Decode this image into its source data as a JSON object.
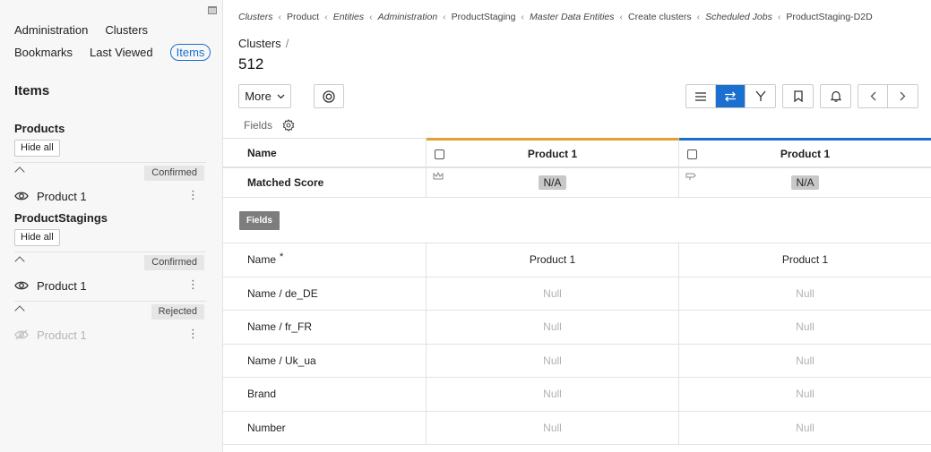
{
  "sidebar": {
    "nav": {
      "administration": "Administration",
      "clusters": "Clusters",
      "bookmarks": "Bookmarks",
      "last_viewed": "Last Viewed",
      "items": "Items"
    },
    "title": "Items",
    "groups": [
      {
        "title": "Products",
        "hide_all": "Hide all",
        "statuses": [
          {
            "status": "Confirmed",
            "item": "Product 1",
            "visible": true
          }
        ]
      },
      {
        "title": "ProductStagings",
        "hide_all": "Hide all",
        "statuses": [
          {
            "status": "Confirmed",
            "item": "Product 1",
            "visible": true
          },
          {
            "status": "Rejected",
            "item": "Product 1",
            "visible": false
          }
        ]
      }
    ]
  },
  "breadcrumb": [
    {
      "label": "Clusters",
      "italic": true
    },
    {
      "label": "Product",
      "italic": false
    },
    {
      "label": "Entities",
      "italic": true
    },
    {
      "label": "Administration",
      "italic": true
    },
    {
      "label": "ProductStaging",
      "italic": false
    },
    {
      "label": "Master Data Entities",
      "italic": true
    },
    {
      "label": "Create clusters",
      "italic": false
    },
    {
      "label": "Scheduled Jobs",
      "italic": true
    },
    {
      "label": "ProductStaging-D2D",
      "italic": false
    }
  ],
  "header": {
    "section": "Clusters",
    "count": "512",
    "more_label": "More",
    "fields_label": "Fields"
  },
  "table": {
    "name_header": "Name",
    "columns": [
      "Product 1",
      "Product 1"
    ],
    "column_colors": [
      "#e0a233",
      "#1a6fcf"
    ],
    "score_label": "Matched Score",
    "scores": [
      "N/A",
      "N/A"
    ],
    "section_label": "Fields",
    "rows": [
      {
        "label": "Name",
        "required": "*",
        "values": [
          "Product 1",
          "Product 1"
        ],
        "null": false
      },
      {
        "label": "Name / de_DE",
        "required": "",
        "values": [
          "Null",
          "Null"
        ],
        "null": true
      },
      {
        "label": "Name / fr_FR",
        "required": "",
        "values": [
          "Null",
          "Null"
        ],
        "null": true
      },
      {
        "label": "Name / Uk_ua",
        "required": "",
        "values": [
          "Null",
          "Null"
        ],
        "null": true
      },
      {
        "label": "Brand",
        "required": "",
        "values": [
          "Null",
          "Null"
        ],
        "null": true
      },
      {
        "label": "Number",
        "required": "",
        "values": [
          "Null",
          "Null"
        ],
        "null": true
      }
    ]
  }
}
